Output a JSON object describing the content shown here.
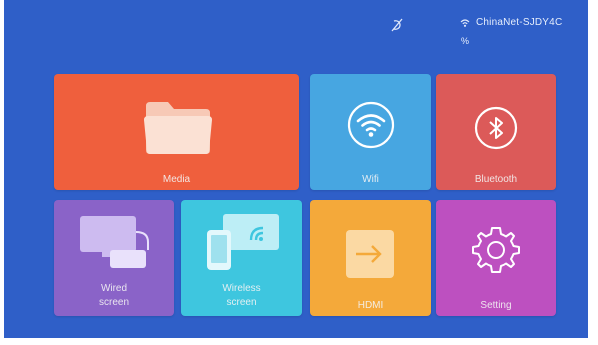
{
  "status": {
    "network_name": "ChinaNet-SJDY4C",
    "network_sub": "%"
  },
  "tiles": {
    "media": "Media",
    "wifi": "Wifi",
    "bluetooth": "Bluetooth",
    "wired": [
      "Wired",
      "screen"
    ],
    "wireless": [
      "Wireless",
      "screen"
    ],
    "hdmi": "HDMI",
    "setting": "Setting"
  },
  "colors": {
    "background": "#2f5fc8",
    "media": "#ef5f3d",
    "wifi": "#47a6e1",
    "bluetooth": "#dc5a59",
    "wired": "#8a63c8",
    "wireless": "#3ec6df",
    "hdmi": "#f4a93a",
    "setting": "#bd50c0"
  }
}
